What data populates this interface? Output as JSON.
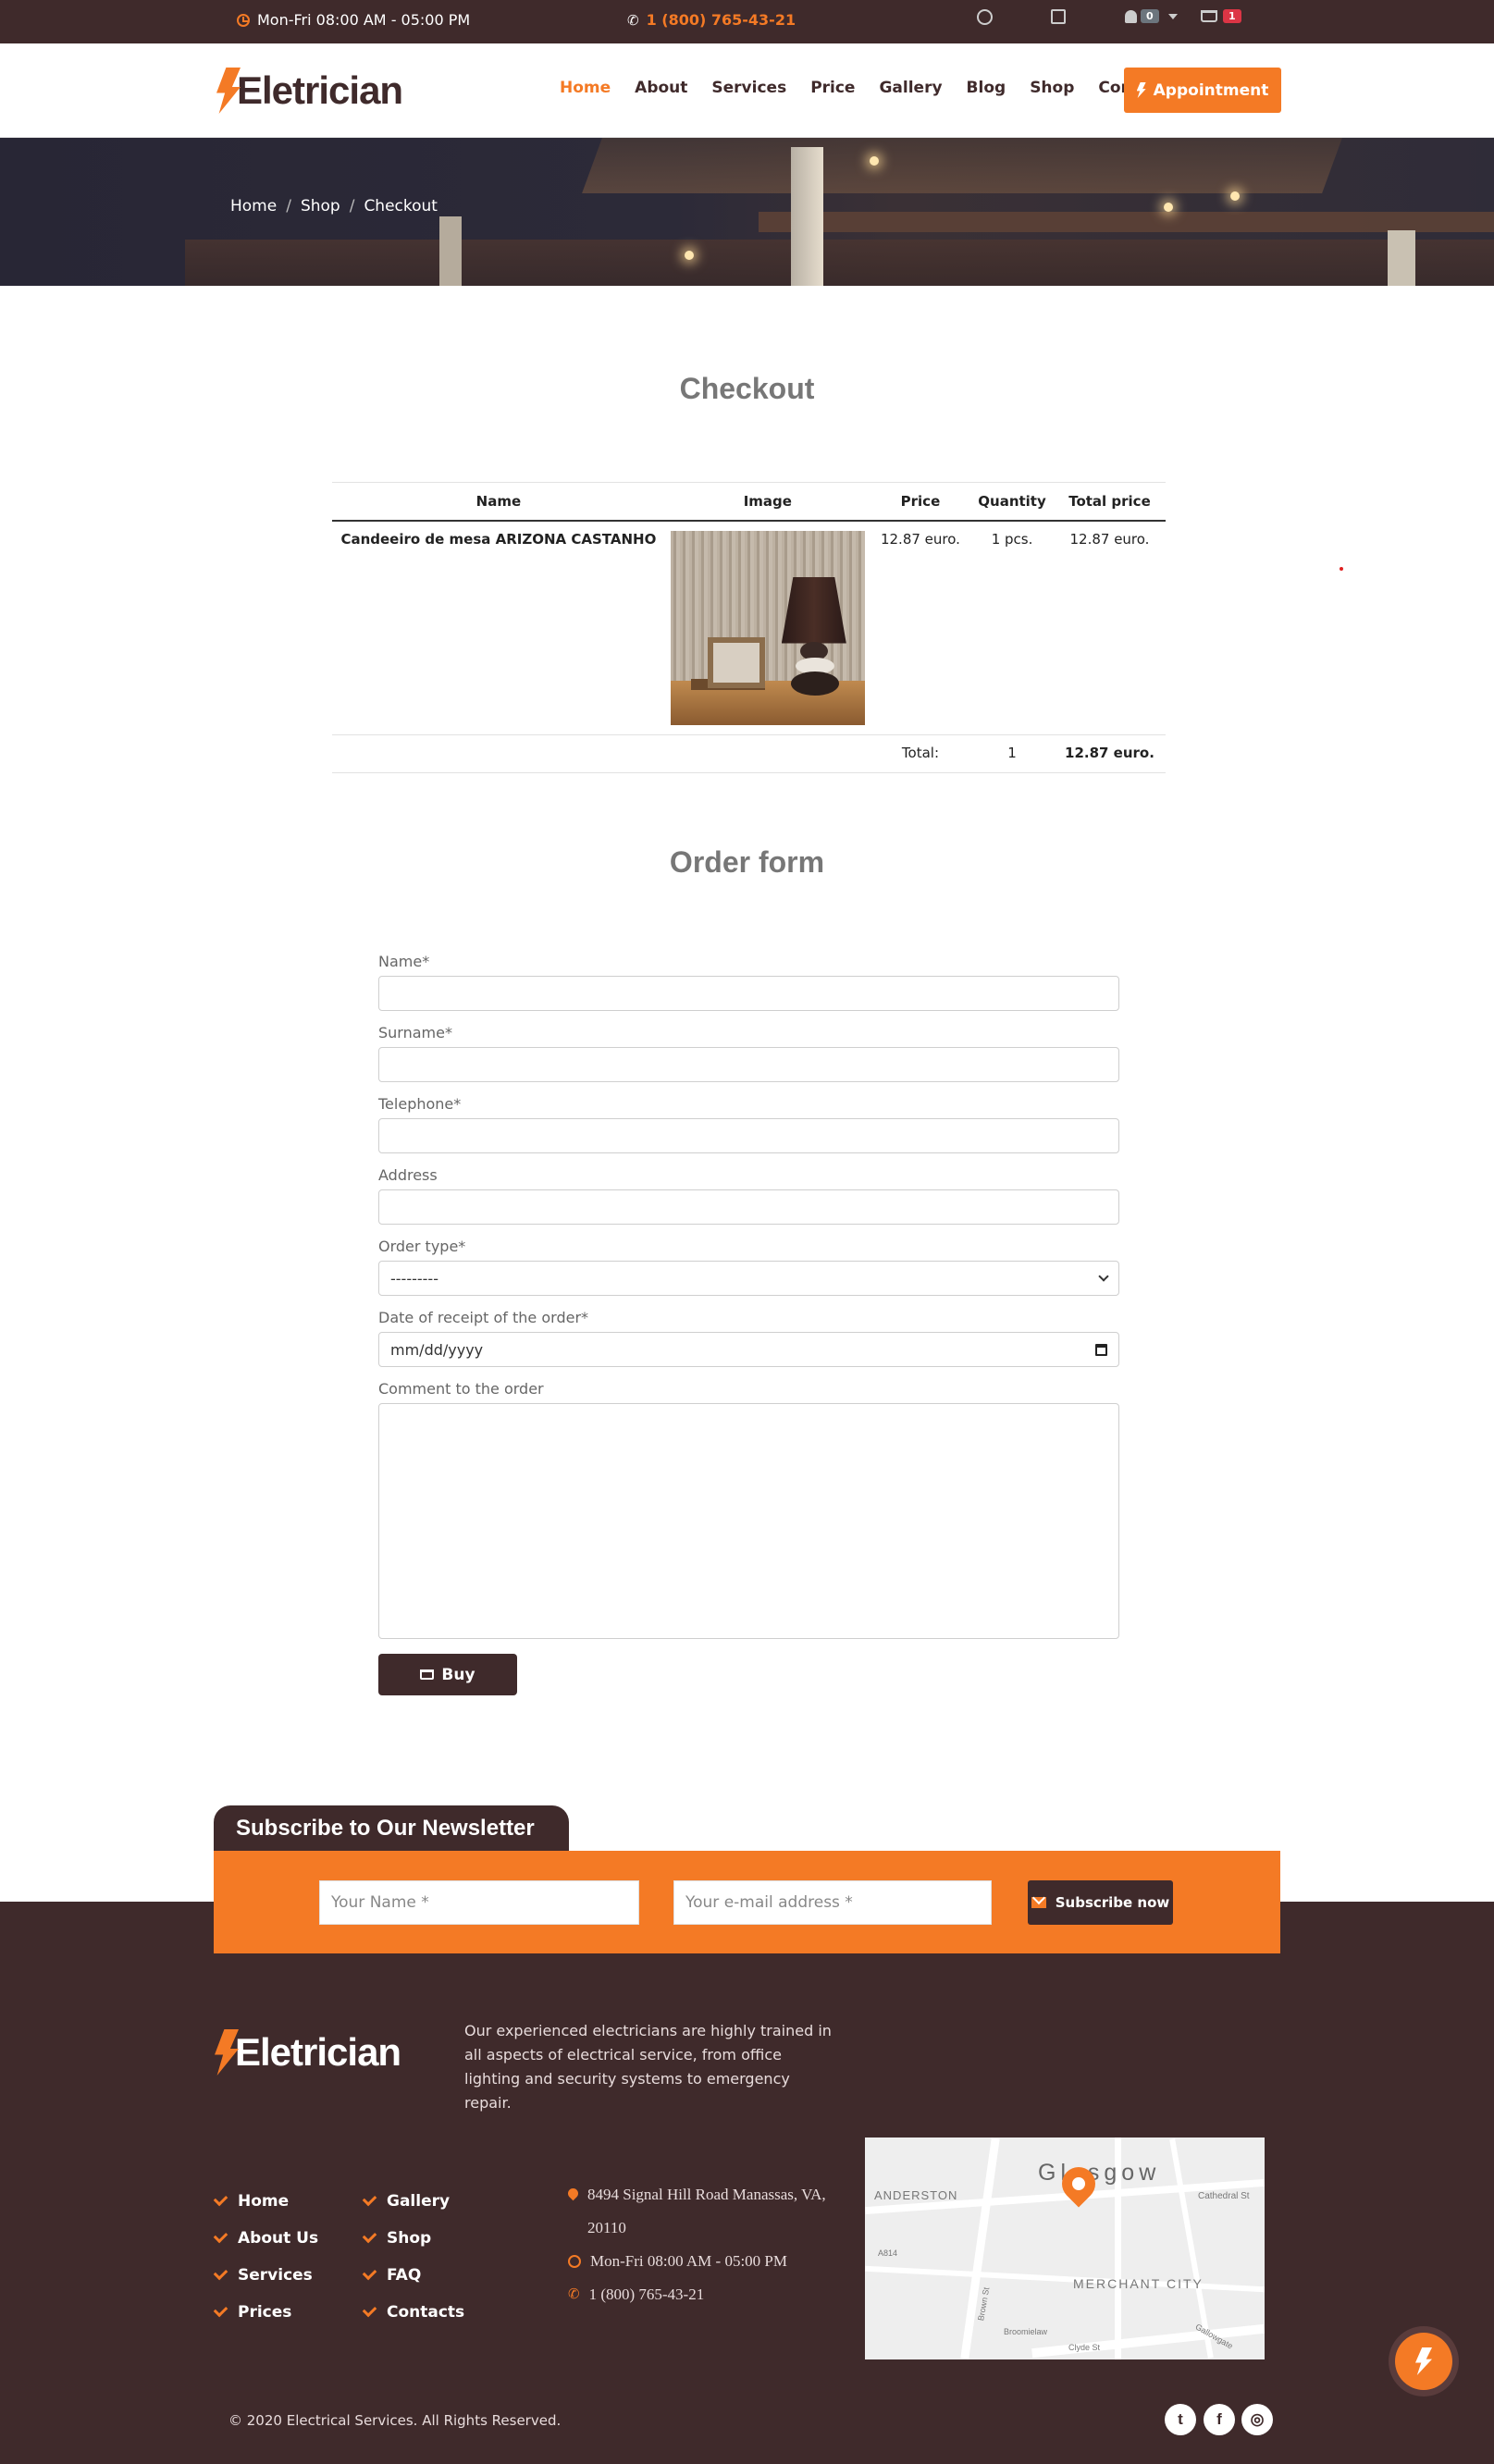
{
  "topbar": {
    "hours": "Mon-Fri 08:00 AM - 05:00 PM",
    "phone": "1 (800) 765-43-21",
    "notifications_count": "0",
    "cart_count": "1"
  },
  "header": {
    "logo_text": "Eletrician",
    "nav": [
      "Home",
      "About",
      "Services",
      "Price",
      "Gallery",
      "Blog",
      "Shop",
      "Contact"
    ],
    "active_nav": "Home",
    "appointment_label": "Appointment"
  },
  "breadcrumb": [
    "Home",
    "Shop",
    "Checkout"
  ],
  "checkout": {
    "title": "Checkout",
    "columns": [
      "Name",
      "Image",
      "Price",
      "Quantity",
      "Total price"
    ],
    "items": [
      {
        "name": "Candeeiro de mesa ARIZONA CASTANHO",
        "price": "12.87 euro.",
        "quantity": "1 pcs.",
        "total": "12.87 euro."
      }
    ],
    "total_label": "Total:",
    "total_quantity": "1",
    "total_price": "12.87 euro."
  },
  "order_form": {
    "title": "Order form",
    "name_label": "Name*",
    "surname_label": "Surname*",
    "telephone_label": "Telephone*",
    "address_label": "Address",
    "order_type_label": "Order type*",
    "order_type_value": "---------",
    "date_label": "Date of receipt of the order*",
    "date_placeholder": "mm/dd/yyyy",
    "comment_label": "Comment to the order",
    "buy_label": "Buy"
  },
  "newsletter": {
    "title": "Subscribe to Our Newsletter",
    "name_placeholder": "Your Name *",
    "email_placeholder": "Your e-mail address *",
    "button_label": "Subscribe now"
  },
  "footer": {
    "logo_text": "Eletrician",
    "description": "Our experienced electricians are highly trained in all aspects of electrical service, from office lighting and security systems to emergency repair.",
    "links_col1": [
      "Home",
      "About Us",
      "Services",
      "Prices"
    ],
    "links_col2": [
      "Gallery",
      "Shop",
      "FAQ",
      "Contacts"
    ],
    "address": "8494 Signal Hill Road Manassas, VA, 20110",
    "hours": "Mon-Fri 08:00 AM - 05:00 PM",
    "phone": "1 (800) 765-43-21",
    "map_labels": [
      "ANDERSTON",
      "Glasgow",
      "MERCHANT CITY",
      "Cathedral St",
      "Brown St",
      "Broomielaw",
      "Clyde St",
      "Gallowgate",
      "A814"
    ],
    "copyright": "© 2020 Electrical Services. All Rights Reserved."
  },
  "colors": {
    "brand_dark": "#3f2a2b",
    "accent_orange": "#f47a25"
  }
}
